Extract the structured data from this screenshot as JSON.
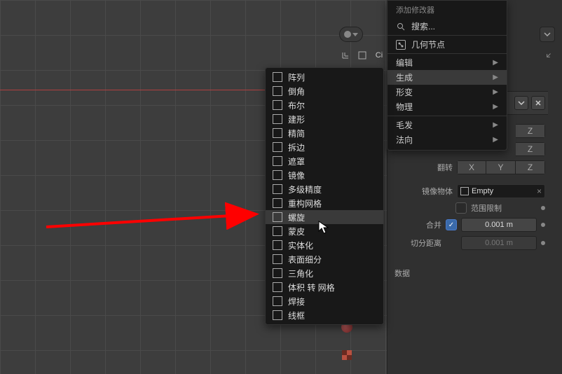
{
  "main_menu": {
    "header": "添加修改器",
    "search": "搜索...",
    "geometry_nodes": "几何节点",
    "edit": "编辑",
    "generate": "生成",
    "deform": "形变",
    "physics": "物理",
    "hair": "毛发",
    "normals": "法向"
  },
  "generate_submenu": {
    "items": [
      {
        "label": "阵列",
        "hl": false
      },
      {
        "label": "倒角",
        "hl": false
      },
      {
        "label": "布尔",
        "hl": false
      },
      {
        "label": "建形",
        "hl": false
      },
      {
        "label": "精简",
        "hl": false
      },
      {
        "label": "拆边",
        "hl": false
      },
      {
        "label": "遮罩",
        "hl": false
      },
      {
        "label": "镜像",
        "hl": false
      },
      {
        "label": "多级精度",
        "hl": false
      },
      {
        "label": "重构网格",
        "hl": false
      },
      {
        "label": "螺旋",
        "hl": true
      },
      {
        "label": "蒙皮",
        "hl": false
      },
      {
        "label": "实体化",
        "hl": false
      },
      {
        "label": "表面细分",
        "hl": false
      },
      {
        "label": "三角化",
        "hl": false
      },
      {
        "label": "体积 转 网格",
        "hl": false
      },
      {
        "label": "焊接",
        "hl": false
      },
      {
        "label": "线框",
        "hl": false
      }
    ]
  },
  "mirror_panel": {
    "axis_x": "X",
    "axis_y": "Y",
    "axis_z": "Z",
    "z_only": "Z",
    "flip_label": "翻转",
    "mirror_object_label": "镜像物体",
    "mirror_object_value": "Empty",
    "range_limit": "范围限制",
    "merge_label": "合并",
    "merge_value": "0.001 m",
    "cut_label": "切分距离",
    "cut_value": "0.001 m",
    "data_header": "数据"
  },
  "tool_header": {
    "crop_prefix": "Ci"
  }
}
